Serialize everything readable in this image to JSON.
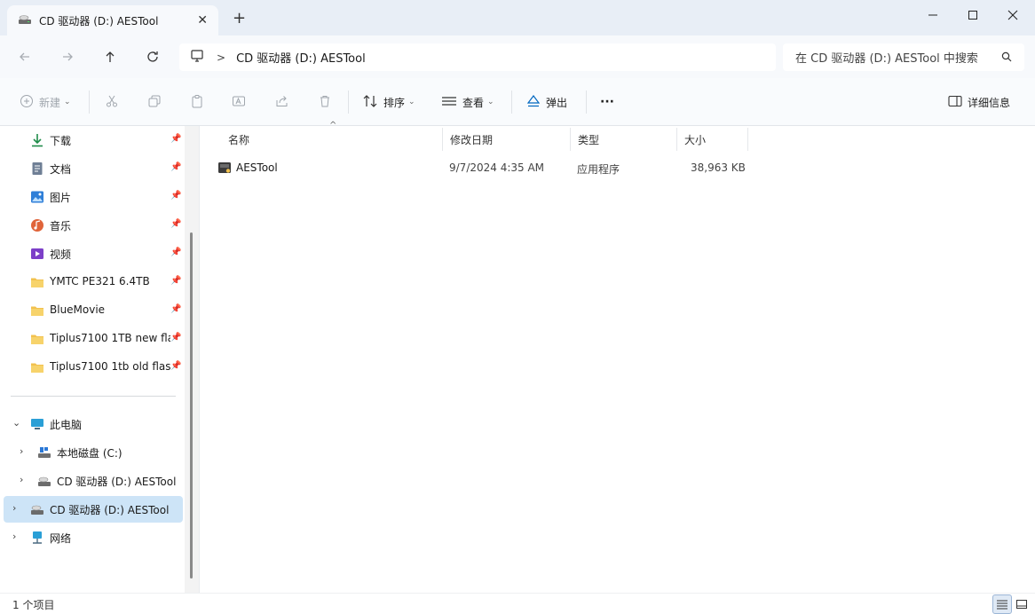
{
  "window": {
    "tab_title": "CD 驱动器 (D:) AESTool",
    "new_tab": "+",
    "tab_close": "✕"
  },
  "nav": {
    "breadcrumb_sep": ">",
    "path": "CD 驱动器 (D:) AESTool",
    "search_placeholder": "在 CD 驱动器 (D:) AESTool 中搜索"
  },
  "toolbar": {
    "new_label": "新建",
    "sort_label": "排序",
    "view_label": "查看",
    "eject_label": "弹出",
    "more_label": "···",
    "details_label": "详细信息"
  },
  "sidebar": {
    "quick_access": [
      {
        "label": "下载",
        "icon": "download-icon"
      },
      {
        "label": "文档",
        "icon": "document-icon"
      },
      {
        "label": "图片",
        "icon": "pictures-icon"
      },
      {
        "label": "音乐",
        "icon": "music-icon"
      },
      {
        "label": "视频",
        "icon": "video-icon"
      },
      {
        "label": "YMTC PE321 6.4TB",
        "icon": "folder-icon"
      },
      {
        "label": "BlueMovie",
        "icon": "folder-icon"
      },
      {
        "label": "Tiplus7100 1TB new fla",
        "icon": "folder-icon"
      },
      {
        "label": "Tiplus7100 1tb old flasl",
        "icon": "folder-icon"
      }
    ],
    "this_pc": "此电脑",
    "drives": [
      {
        "label": "本地磁盘 (C:)",
        "icon": "drive-icon"
      },
      {
        "label": "CD 驱动器 (D:) AESTool",
        "icon": "cd-drive-icon"
      }
    ],
    "selected_item": "CD 驱动器 (D:) AESTool",
    "network": "网络"
  },
  "table": {
    "columns": [
      "名称",
      "修改日期",
      "类型",
      "大小"
    ],
    "rows": [
      {
        "name": "AESTool",
        "modified": "9/7/2024 4:35 AM",
        "type": "应用程序",
        "size": "38,963 KB"
      }
    ]
  },
  "status": {
    "item_count": "1 个项目"
  },
  "colors": {
    "accent": "#0067c0",
    "selected_bg": "#cde4f7",
    "folder": "#f2c14e"
  }
}
